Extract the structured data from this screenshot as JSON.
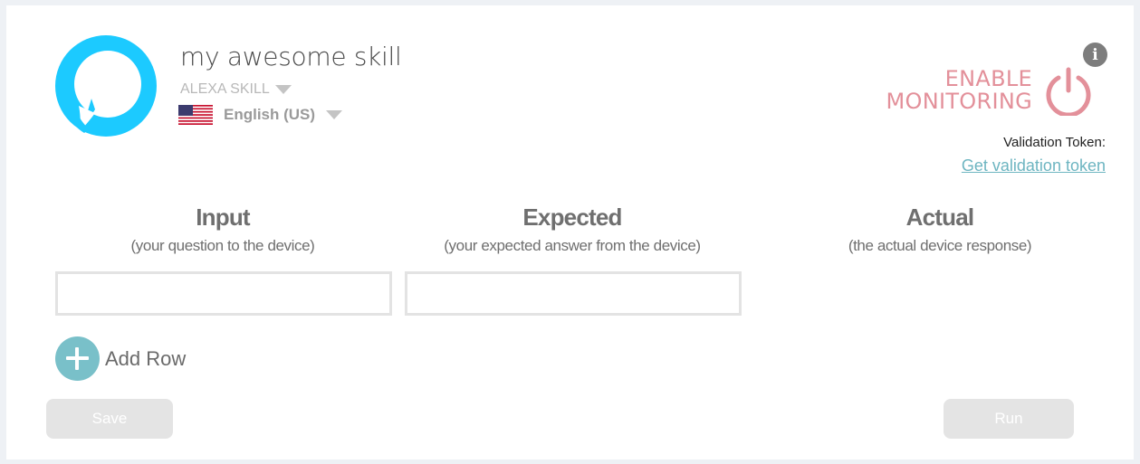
{
  "skill": {
    "name": "my awesome skill",
    "type_label": "ALEXA SKILL",
    "language_label": "English (US)",
    "logo_icon": "alexa-ring-icon",
    "flag_icon": "us-flag-icon"
  },
  "monitoring": {
    "line1": "ENABLE",
    "line2": "MONITORING",
    "icon": "power-icon",
    "color": "#e3909a"
  },
  "info_icon": {
    "glyph": "i",
    "icon": "info-icon"
  },
  "validation": {
    "label": "Validation Token:",
    "link_text": "Get validation token"
  },
  "columns": [
    {
      "title": "Input",
      "subtitle": "(your question to the device)"
    },
    {
      "title": "Expected",
      "subtitle": "(your expected answer from the device)"
    },
    {
      "title": "Actual",
      "subtitle": "(the actual device response)"
    }
  ],
  "rows": [
    {
      "input": "",
      "expected": "",
      "actual": ""
    }
  ],
  "add_row": {
    "label": "Add Row",
    "icon": "plus-icon",
    "color": "#79c0c9"
  },
  "buttons": {
    "save": "Save",
    "run": "Run"
  },
  "colors": {
    "alexa_blue": "#1ccaff",
    "link": "#6db5c1",
    "button_disabled": "#e4e4e4"
  }
}
